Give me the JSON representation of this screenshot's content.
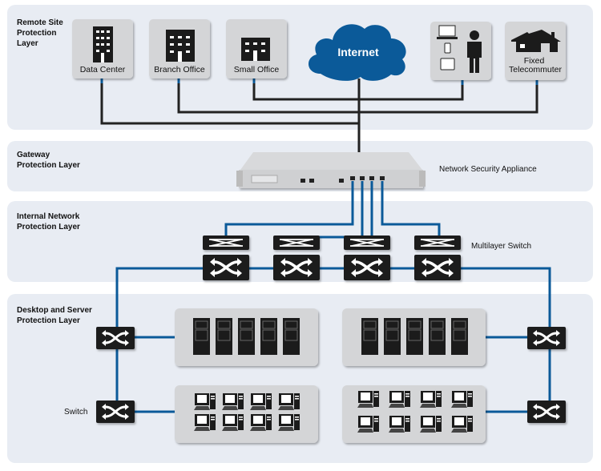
{
  "layers": {
    "remote": [
      "Remote Site",
      "Protection",
      "Layer"
    ],
    "gateway": [
      "Gateway",
      "Protection Layer"
    ],
    "internal": [
      "Internal Network",
      "Protection Layer"
    ],
    "desktop": [
      "Desktop and Server",
      "Protection Layer"
    ]
  },
  "sites": {
    "data_center": "Data Center",
    "branch_office": "Branch Office",
    "small_office": "Small Office",
    "internet": "Internet",
    "telecommuter": [
      "Fixed",
      "Telecommuter"
    ]
  },
  "labels": {
    "appliance": "Network Security Appliance",
    "multilayer_switch": "Multilayer Switch",
    "switch": "Switch"
  },
  "colors": {
    "band": "#e8ecf3",
    "box": "#d4d5d7",
    "cloud": "#0b5a99",
    "blue_link": "#0b5a99",
    "black_cable": "#222222"
  }
}
